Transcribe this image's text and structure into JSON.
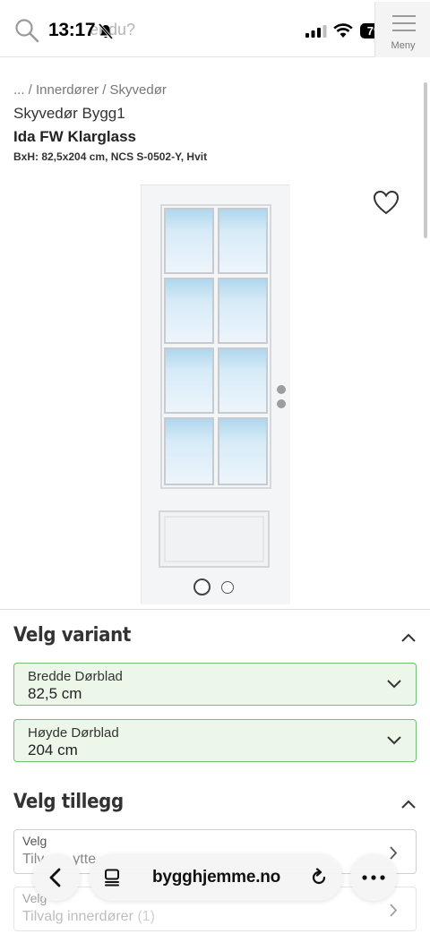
{
  "status_bar": {
    "time": "13:17",
    "battery": "79"
  },
  "header": {
    "search_placeholder": "er du?",
    "menu_label": "Meny"
  },
  "product": {
    "breadcrumb": "... / Innerdører / Skyvedør",
    "category": "Skyvedør Bygg1",
    "title": "Ida FW Klarglass",
    "spec": "BxH: 82,5x204 cm, NCS S-0502-Y, Hvit",
    "image_count": 2,
    "active_image": 1
  },
  "variant": {
    "title": "Velg variant",
    "fields": [
      {
        "label": "Bredde Dørblad",
        "value": "82,5 cm"
      },
      {
        "label": "Høyde Dørblad",
        "value": "204 cm"
      }
    ]
  },
  "addons": {
    "title": "Velg tillegg",
    "fields": [
      {
        "label": "Velg",
        "value": "Tilv",
        "value_tail": "ytte"
      },
      {
        "label": "Velg",
        "value": "Tilvalg innerdører",
        "count": "(1)"
      }
    ]
  },
  "browser": {
    "url": "bygghjemme.no"
  },
  "colors": {
    "select_border": "#6fc26f",
    "select_bg": "#ecf7ea"
  }
}
